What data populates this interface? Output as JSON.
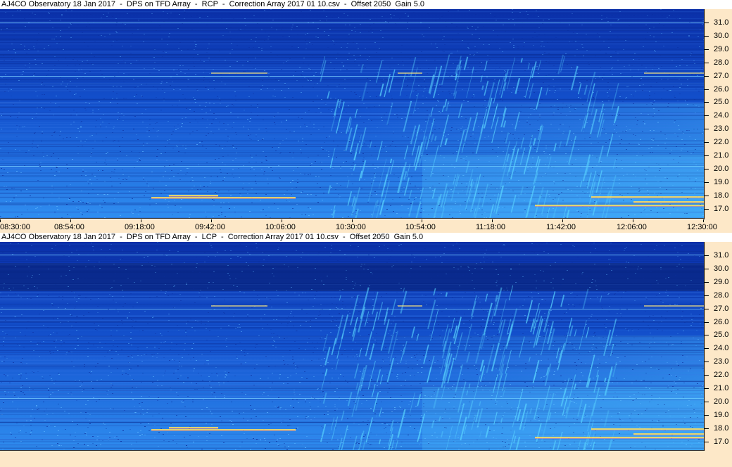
{
  "panels": [
    {
      "title": "AJ4CO Observatory 18 Jan 2017  -  DPS on TFD Array  -  RCP  -  Correction Array 2017 01 10.csv  -  Offset 2050  Gain 5.0"
    },
    {
      "title": "AJ4CO Observatory 18 Jan 2017  -  DPS on TFD Array  -  LCP  -  Correction Array 2017 01 10.csv  -  Offset 2050  Gain 5.0"
    }
  ],
  "freq_labels": [
    "31.0",
    "30.0",
    "29.0",
    "28.0",
    "27.0",
    "26.0",
    "25.0",
    "24.0",
    "23.0",
    "22.0",
    "21.0",
    "20.0",
    "19.0",
    "18.0",
    "17.0"
  ],
  "time_labels": [
    "08:30:00",
    "08:54:00",
    "09:18:00",
    "09:42:00",
    "10:06:00",
    "10:30:00",
    "10:54:00",
    "11:18:00",
    "11:42:00",
    "12:06:00",
    "12:30:00"
  ],
  "colors": {
    "axis_bg": "#fde8c8",
    "spec_top": "#0a2fa8",
    "spec_bottom": "#2f8ef0",
    "burst": "#5ad6ff",
    "hot": "#ffe15a"
  }
}
